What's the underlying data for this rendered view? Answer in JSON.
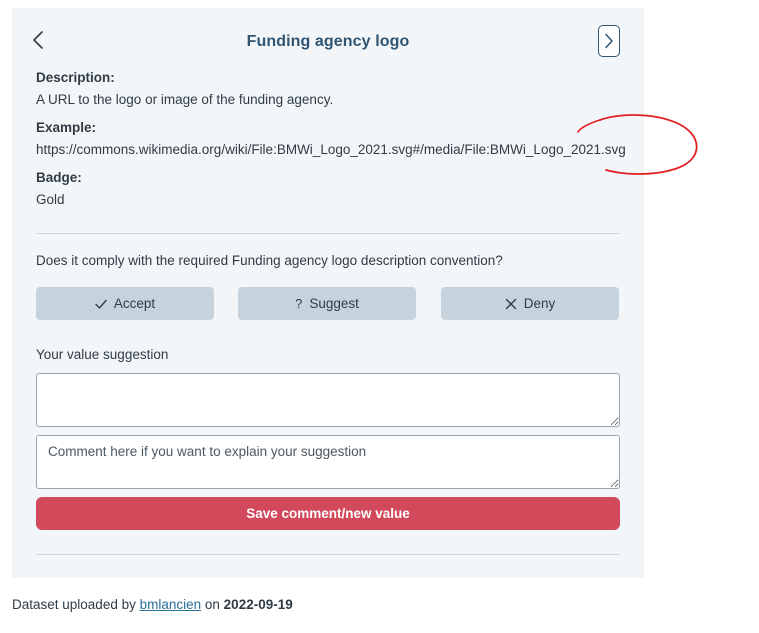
{
  "header": {
    "title": "Funding agency logo",
    "back_icon": "chevron-left-icon",
    "next_icon": "chevron-right-icon"
  },
  "info": {
    "description_label": "Description:",
    "description_value": "A URL to the logo or image of the funding agency.",
    "example_label": "Example:",
    "example_value": "https://commons.wikimedia.org/wiki/File:BMWi_Logo_2021.svg#/media/File:BMWi_Logo_2021.svg",
    "badge_label": "Badge:",
    "badge_value": "Gold"
  },
  "review": {
    "question": "Does it comply with the required Funding agency logo description convention?",
    "accept_label": "Accept",
    "suggest_label": "Suggest",
    "deny_label": "Deny",
    "accept_icon": "check-icon",
    "suggest_icon": "question-icon",
    "deny_icon": "x-icon"
  },
  "suggestion": {
    "label": "Your value suggestion",
    "value_placeholder": "",
    "comment_placeholder": "Comment here if you want to explain your suggestion",
    "save_label": "Save comment/new value"
  },
  "footer": {
    "prefix": "Dataset uploaded by ",
    "user": "bmlancien",
    "middle": " on ",
    "date": "2022-09-19"
  },
  "colors": {
    "card_bg": "#f3f6f9",
    "title": "#2f5573",
    "choice_bg": "#c7d3dc",
    "save_bg": "#d1495b",
    "annotation": "#e01e1e",
    "link": "#2a6f97"
  }
}
